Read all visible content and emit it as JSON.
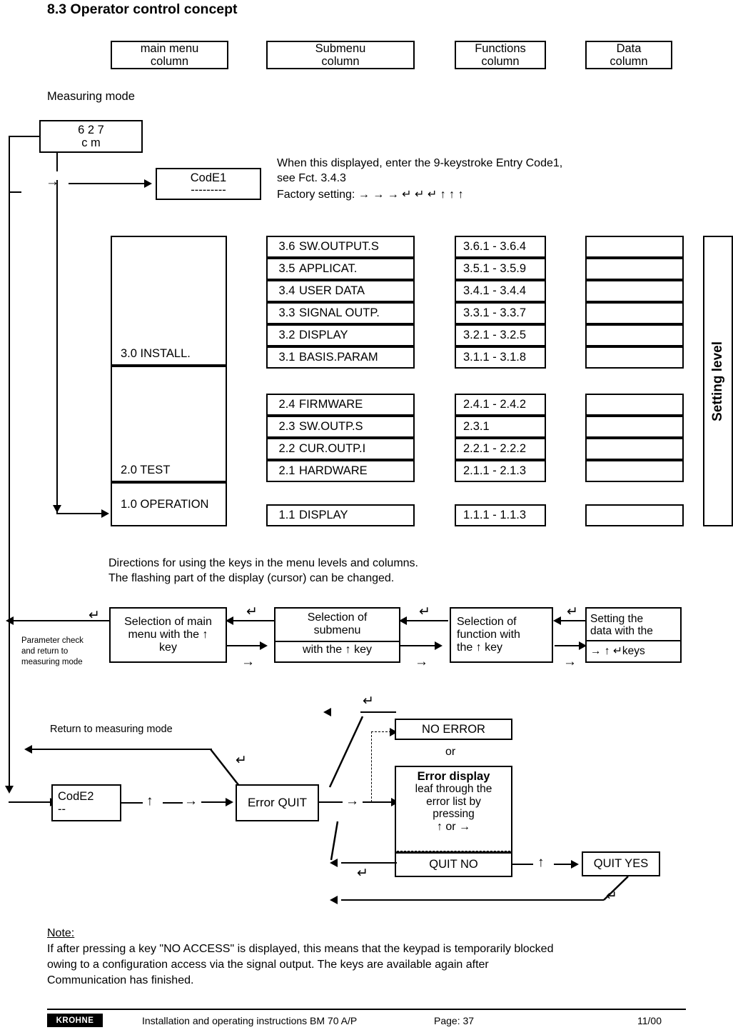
{
  "page": {
    "heading": "8.3 Operator control concept",
    "measuring_mode_label": "Measuring mode",
    "directions_line1": "Directions for using the keys in the menu levels and columns.",
    "directions_line2": "The flashing part of the display (cursor) can be changed.",
    "setting_level_label": "Setting level"
  },
  "column_headers": [
    {
      "line1": "main menu",
      "line2": "column"
    },
    {
      "line1": "Submenu",
      "line2": "column"
    },
    {
      "line1": "Functions",
      "line2": "column"
    },
    {
      "line1": "Data",
      "line2": "column"
    }
  ],
  "display": {
    "value": "6 2 7",
    "unit": "c m"
  },
  "code1": {
    "label": "CodE1",
    "value": "---------",
    "note_line1": "When this displayed, enter the 9-keystroke Entry Code1,",
    "note_line2": "see Fct. 3.4.3",
    "note_line3": "Factory setting: → → → ↵ ↵ ↵ ↑ ↑ ↑"
  },
  "menu": {
    "main": [
      {
        "label": "3.0  INSTALL."
      },
      {
        "label": "2.0  TEST"
      },
      {
        "label": "1.0  OPERATION"
      }
    ],
    "install_submenus": [
      {
        "num": "3.6",
        "name": "SW.OUTPUT.S",
        "functions": "3.6.1 - 3.6.4"
      },
      {
        "num": "3.5",
        "name": "APPLICAT.",
        "functions": "3.5.1 - 3.5.9"
      },
      {
        "num": "3.4",
        "name": "USER DATA",
        "functions": "3.4.1 - 3.4.4"
      },
      {
        "num": "3.3",
        "name": "SIGNAL OUTP.",
        "functions": "3.3.1 - 3.3.7"
      },
      {
        "num": "3.2",
        "name": "DISPLAY",
        "functions": "3.2.1 - 3.2.5"
      },
      {
        "num": "3.1",
        "name": "BASIS.PARAM",
        "functions": "3.1.1 - 3.1.8"
      }
    ],
    "test_submenus": [
      {
        "num": "2.4",
        "name": "FIRMWARE",
        "functions": "2.4.1 - 2.4.2"
      },
      {
        "num": "2.3",
        "name": "SW.OUTP.S",
        "functions": "2.3.1"
      },
      {
        "num": "2.2",
        "name": "CUR.OUTP.I",
        "functions": "2.2.1 - 2.2.2"
      },
      {
        "num": "2.1",
        "name": "HARDWARE",
        "functions": "2.1.1 - 2.1.3"
      }
    ],
    "operation_submenus": [
      {
        "num": "1.1",
        "name": "DISPLAY",
        "functions": "1.1.1 - 1.1.3"
      }
    ]
  },
  "keyflow": {
    "param_check": "Parameter check\nand return to\nmeasuring mode",
    "box1_line1": "Selection of main",
    "box1_line2": "menu with the ↑",
    "box1_line3": "key",
    "box2_line1": "Selection of",
    "box2_line2": "submenu",
    "box2_line3": "with the ↑ key",
    "box3_line1": "Selection of",
    "box3_line2": "function with",
    "box3_line3": "the ↑ key",
    "box4_line1": "Setting the",
    "box4_line2": "data with the",
    "box4_line3": "→ ↑ ↵keys",
    "enter_glyph": "↵",
    "right_glyph": "→"
  },
  "errorflow": {
    "return_label": "Return to measuring mode",
    "code2_label": "CodE2",
    "code2_value": "--",
    "up_glyph": "↑",
    "right_glyph": "→",
    "enter_glyph": "↵",
    "error_quit": "Error QUIT",
    "no_error": "NO ERROR",
    "or_label": "or",
    "error_display_title": "Error display",
    "error_display_line1": "leaf through the",
    "error_display_line2": "error list by",
    "error_display_line3": "pressing",
    "error_display_keys": "↑     or    →",
    "quit_no": "QUIT NO",
    "quit_yes": "QUIT YES"
  },
  "note": {
    "title": "Note:",
    "line1": "If after pressing a key \"NO ACCESS\" is displayed, this means that the keypad is temporarily blocked",
    "line2": "owing to a configuration access via the signal output. The keys are available again after",
    "line3": "Communication has finished."
  },
  "footer": {
    "logo": "KROHNE",
    "doc_title": "Installation and operating instructions BM 70 A/P",
    "page": "Page: 37",
    "date": "11/00"
  }
}
